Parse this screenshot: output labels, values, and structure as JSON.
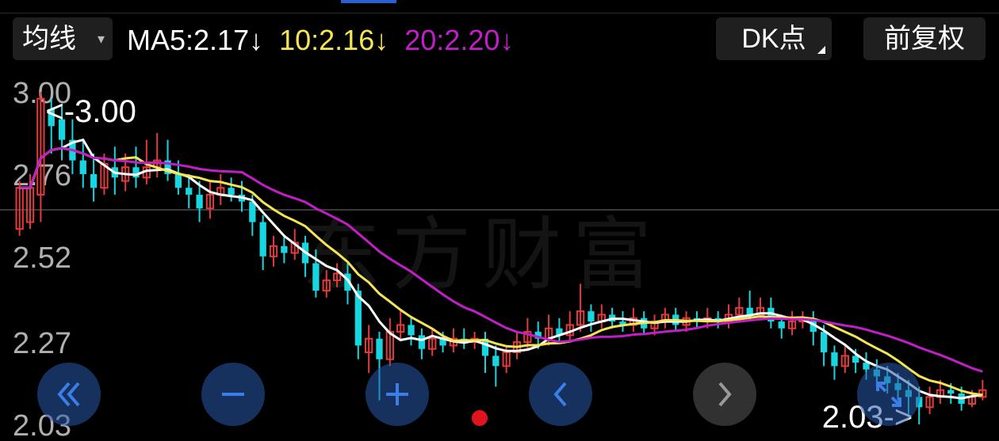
{
  "header": {
    "period_label": "均线",
    "period_caret": "▾",
    "ma5": "MA5:2.17↓",
    "ma10": "10:2.16↓",
    "ma20": "20:2.20↓",
    "dk_label": "DK点",
    "fq_label": "前复权"
  },
  "colors": {
    "ma5": "#ffffff",
    "ma10": "#f5e453",
    "ma20": "#c21ec8",
    "up": "#e23b3b",
    "down": "#18d6e0",
    "control_blue": "#285aaa"
  },
  "watermark": "东方财富",
  "markers": {
    "high": "<-3.00",
    "low": "2.03->"
  },
  "chart_data": {
    "type": "candlestick",
    "y_ticks": [
      "3.00",
      "2.76",
      "2.52",
      "2.27",
      "2.03"
    ],
    "ylim": [
      2.03,
      3.0
    ],
    "high_value": 3.0,
    "low_value": 2.03,
    "candles": [
      [
        2.6,
        2.72,
        2.58,
        2.74
      ],
      [
        2.62,
        2.72,
        2.6,
        2.76
      ],
      [
        2.7,
        2.98,
        2.62,
        3.0
      ],
      [
        2.95,
        2.9,
        2.82,
        2.98
      ],
      [
        2.92,
        2.86,
        2.8,
        2.96
      ],
      [
        2.86,
        2.8,
        2.76,
        2.92
      ],
      [
        2.8,
        2.76,
        2.72,
        2.86
      ],
      [
        2.76,
        2.72,
        2.68,
        2.82
      ],
      [
        2.72,
        2.79,
        2.7,
        2.82
      ],
      [
        2.78,
        2.75,
        2.7,
        2.84
      ],
      [
        2.74,
        2.78,
        2.71,
        2.82
      ],
      [
        2.78,
        2.75,
        2.72,
        2.84
      ],
      [
        2.75,
        2.78,
        2.73,
        2.86
      ],
      [
        2.78,
        2.8,
        2.75,
        2.88
      ],
      [
        2.8,
        2.76,
        2.74,
        2.86
      ],
      [
        2.76,
        2.72,
        2.7,
        2.8
      ],
      [
        2.72,
        2.7,
        2.66,
        2.76
      ],
      [
        2.7,
        2.66,
        2.62,
        2.74
      ],
      [
        2.66,
        2.7,
        2.63,
        2.74
      ],
      [
        2.7,
        2.72,
        2.67,
        2.76
      ],
      [
        2.72,
        2.7,
        2.68,
        2.75
      ],
      [
        2.7,
        2.68,
        2.65,
        2.74
      ],
      [
        2.68,
        2.62,
        2.58,
        2.7
      ],
      [
        2.62,
        2.52,
        2.48,
        2.64
      ],
      [
        2.52,
        2.55,
        2.49,
        2.58
      ],
      [
        2.55,
        2.53,
        2.5,
        2.58
      ],
      [
        2.53,
        2.56,
        2.51,
        2.6
      ],
      [
        2.56,
        2.5,
        2.46,
        2.58
      ],
      [
        2.5,
        2.42,
        2.4,
        2.54
      ],
      [
        2.42,
        2.45,
        2.4,
        2.48
      ],
      [
        2.45,
        2.47,
        2.43,
        2.5
      ],
      [
        2.47,
        2.42,
        2.38,
        2.5
      ],
      [
        2.42,
        2.26,
        2.22,
        2.44
      ],
      [
        2.24,
        2.28,
        2.18,
        2.32
      ],
      [
        2.28,
        2.22,
        2.1,
        2.3
      ],
      [
        2.22,
        2.3,
        2.2,
        2.34
      ],
      [
        2.3,
        2.32,
        2.28,
        2.36
      ],
      [
        2.32,
        2.29,
        2.26,
        2.34
      ],
      [
        2.29,
        2.25,
        2.22,
        2.31
      ],
      [
        2.25,
        2.28,
        2.23,
        2.31
      ],
      [
        2.28,
        2.26,
        2.24,
        2.3
      ],
      [
        2.26,
        2.28,
        2.24,
        2.31
      ],
      [
        2.28,
        2.27,
        2.25,
        2.31
      ],
      [
        2.27,
        2.28,
        2.25,
        2.3
      ],
      [
        2.28,
        2.23,
        2.18,
        2.3
      ],
      [
        2.23,
        2.2,
        2.14,
        2.26
      ],
      [
        2.2,
        2.24,
        2.18,
        2.26
      ],
      [
        2.24,
        2.27,
        2.22,
        2.3
      ],
      [
        2.27,
        2.3,
        2.25,
        2.34
      ],
      [
        2.3,
        2.28,
        2.25,
        2.33
      ],
      [
        2.28,
        2.31,
        2.26,
        2.35
      ],
      [
        2.31,
        2.29,
        2.27,
        2.34
      ],
      [
        2.29,
        2.32,
        2.27,
        2.36
      ],
      [
        2.32,
        2.36,
        2.3,
        2.44
      ],
      [
        2.36,
        2.33,
        2.3,
        2.38
      ],
      [
        2.33,
        2.35,
        2.31,
        2.38
      ],
      [
        2.35,
        2.33,
        2.31,
        2.37
      ],
      [
        2.33,
        2.32,
        2.3,
        2.36
      ],
      [
        2.32,
        2.34,
        2.3,
        2.37
      ],
      [
        2.34,
        2.31,
        2.29,
        2.36
      ],
      [
        2.31,
        2.33,
        2.29,
        2.35
      ],
      [
        2.33,
        2.35,
        2.31,
        2.37
      ],
      [
        2.35,
        2.32,
        2.3,
        2.37
      ],
      [
        2.32,
        2.34,
        2.3,
        2.36
      ],
      [
        2.34,
        2.33,
        2.31,
        2.36
      ],
      [
        2.33,
        2.34,
        2.31,
        2.37
      ],
      [
        2.34,
        2.33,
        2.31,
        2.36
      ],
      [
        2.33,
        2.35,
        2.31,
        2.38
      ],
      [
        2.35,
        2.37,
        2.33,
        2.4
      ],
      [
        2.37,
        2.35,
        2.33,
        2.42
      ],
      [
        2.35,
        2.37,
        2.34,
        2.4
      ],
      [
        2.37,
        2.33,
        2.31,
        2.4
      ],
      [
        2.33,
        2.31,
        2.28,
        2.35
      ],
      [
        2.31,
        2.33,
        2.29,
        2.36
      ],
      [
        2.33,
        2.34,
        2.31,
        2.36
      ],
      [
        2.34,
        2.3,
        2.26,
        2.36
      ],
      [
        2.3,
        2.24,
        2.2,
        2.32
      ],
      [
        2.24,
        2.2,
        2.16,
        2.26
      ],
      [
        2.2,
        2.23,
        2.18,
        2.26
      ],
      [
        2.23,
        2.21,
        2.18,
        2.25
      ],
      [
        2.21,
        2.19,
        2.16,
        2.24
      ],
      [
        2.19,
        2.17,
        2.14,
        2.22
      ],
      [
        2.17,
        2.15,
        2.12,
        2.2
      ],
      [
        2.15,
        2.13,
        2.1,
        2.18
      ],
      [
        2.13,
        2.11,
        2.06,
        2.16
      ],
      [
        2.11,
        2.08,
        2.03,
        2.14
      ],
      [
        2.08,
        2.11,
        2.06,
        2.14
      ],
      [
        2.11,
        2.13,
        2.09,
        2.16
      ],
      [
        2.13,
        2.12,
        2.09,
        2.15
      ],
      [
        2.12,
        2.09,
        2.07,
        2.14
      ],
      [
        2.09,
        2.11,
        2.08,
        2.13
      ],
      [
        2.11,
        2.13,
        2.1,
        2.16
      ]
    ]
  }
}
